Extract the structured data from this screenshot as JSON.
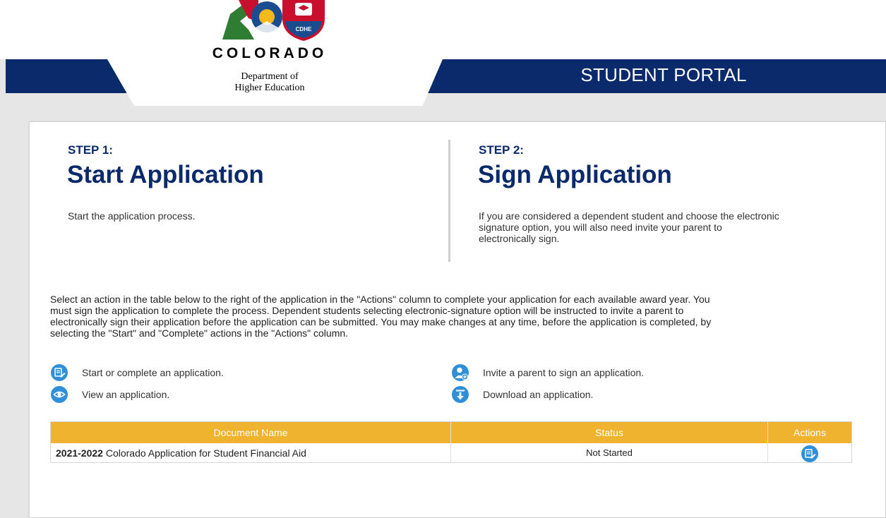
{
  "header": {
    "portal_title": "STUDENT PORTAL",
    "logo": {
      "state_name": "COLORADO",
      "dept_line1": "Department of",
      "dept_line2": "Higher Education",
      "badge_text": "CDHE"
    },
    "colors": {
      "navy": "#0b2a6b",
      "accent_red": "#c8102e",
      "accent_gold": "#f0b32f"
    }
  },
  "steps": [
    {
      "label": "STEP 1:",
      "title": "Start Application",
      "description": "Start the application process."
    },
    {
      "label": "STEP 2:",
      "title": "Sign Application",
      "description_lines": [
        "If you are considered a dependent student and choose the electronic",
        "signature option, you will also need invite your parent to",
        "electronically sign."
      ]
    }
  ],
  "instructions_lines": [
    "Select an action in the table below to the right of the application in the \"Actions\" column to complete your application for each available award year. You",
    "must sign the application to complete the process. Dependent students selecting electronic-signature option will be instructed to invite a parent to",
    "electronically sign their application before the application can be submitted. You may make changes at any time, before the application is completed, by",
    "selecting the \"Start\" and \"Complete\" actions in the \"Actions\" column."
  ],
  "legend": [
    {
      "icon": "edit-form-icon",
      "text": "Start or complete an application."
    },
    {
      "icon": "eye-icon",
      "text": "View an application."
    },
    {
      "icon": "invite-parent-icon",
      "text": "Invite a parent to sign an application."
    },
    {
      "icon": "download-icon",
      "text": "Download an application."
    }
  ],
  "table": {
    "headers": [
      "Document Name",
      "Status",
      "Actions"
    ],
    "rows": [
      {
        "year": "2021-2022",
        "name": "Colorado Application for Student Financial Aid",
        "status": "Not Started",
        "action_icon": "edit-form-icon"
      }
    ]
  }
}
